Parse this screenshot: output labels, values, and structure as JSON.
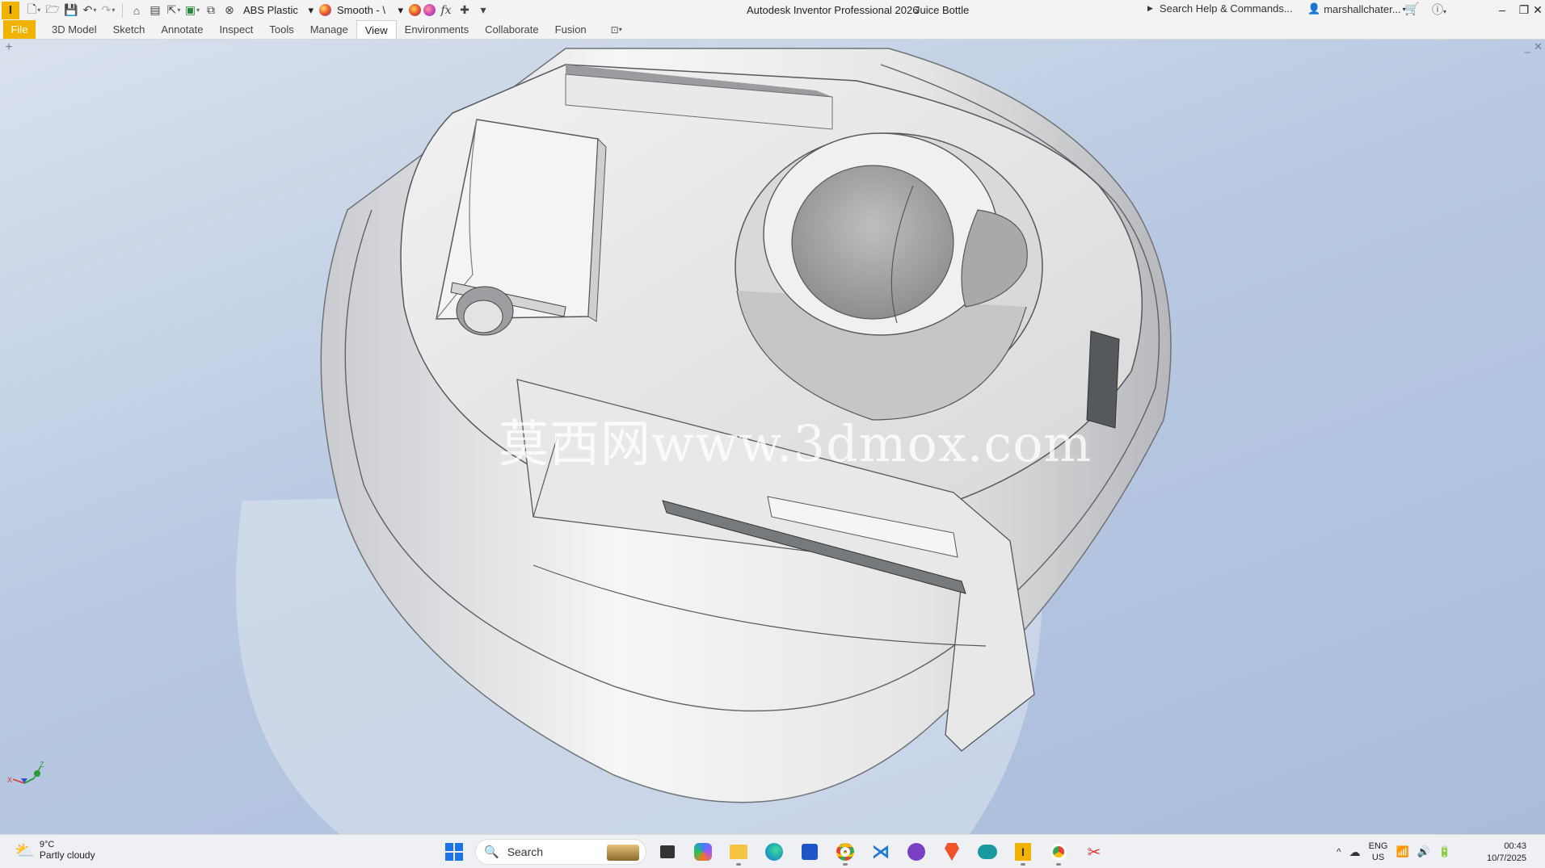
{
  "titlebar": {
    "logo_letter": "I",
    "material": "ABS Plastic",
    "appearance": "Smooth - \\",
    "fx_label": "fx",
    "app_title": "Autodesk Inventor Professional 2026",
    "doc_title": "Juice Bottle",
    "search_help": "Search Help & Commands...",
    "user": "marshallchater..."
  },
  "ribbon": {
    "tabs": [
      {
        "label": "File"
      },
      {
        "label": "3D Model"
      },
      {
        "label": "Sketch"
      },
      {
        "label": "Annotate"
      },
      {
        "label": "Inspect"
      },
      {
        "label": "Tools"
      },
      {
        "label": "Manage"
      },
      {
        "label": "View"
      },
      {
        "label": "Environments"
      },
      {
        "label": "Collaborate"
      },
      {
        "label": "Fusion"
      }
    ],
    "active_tab": "View"
  },
  "viewport": {
    "watermark": "莫西网www.3dmox.com",
    "triad": {
      "x_label": "X",
      "z_label": "Z"
    }
  },
  "taskbar": {
    "weather_temp": "9°C",
    "weather_desc": "Partly cloudy",
    "search_placeholder": "Search",
    "lang_top": "ENG",
    "lang_bottom": "US",
    "time": "00:43",
    "date": "10/7/2025",
    "apps": [
      "task-view-icon",
      "copilot-icon",
      "file-explorer-icon",
      "edge-icon",
      "store-icon",
      "chrome-icon",
      "vscode-icon",
      "github-desktop-icon",
      "brave-icon",
      "arduino-icon",
      "inventor-icon",
      "chrome-profile-icon",
      "snipping-tool-icon"
    ]
  },
  "colors": {
    "accent": "#f0b400",
    "viewport_top": "#d9e1ed",
    "viewport_bottom": "#a9bcdc"
  }
}
